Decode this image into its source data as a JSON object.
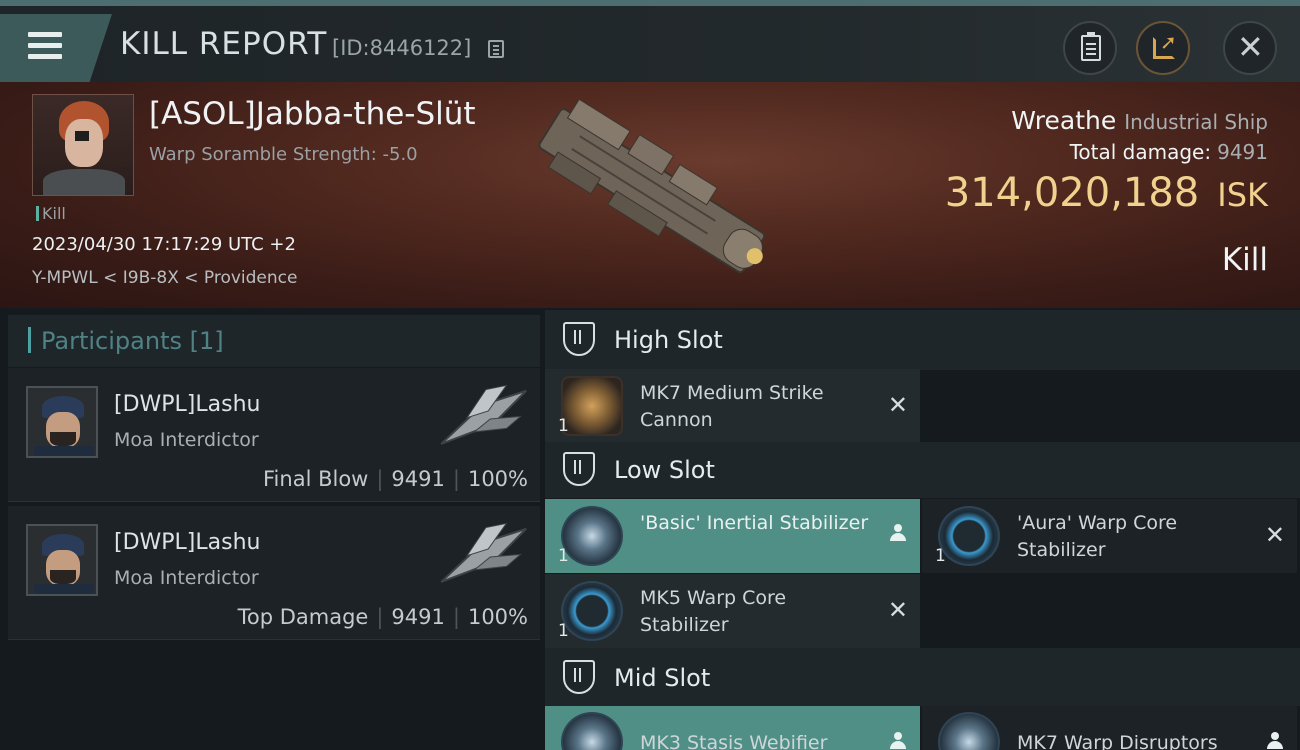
{
  "header": {
    "title": "KILL REPORT",
    "id_label": "[ID:8446122]"
  },
  "victim": {
    "name": "[ASOL]Jabba-the-Slüt",
    "scramble": "Warp Soramble Strength: -5.0",
    "tag": "Kill",
    "timestamp": "2023/04/30 17:17:29 UTC +2",
    "location": "Y-MPWL < I9B-8X < Providence",
    "ship_name": "Wreathe",
    "ship_class": "Industrial Ship",
    "damage_label": "Total damage:",
    "damage_value": "9491",
    "isk_value": "314,020,188",
    "isk_unit": "ISK",
    "result": "Kill"
  },
  "participants": {
    "title": "Participants [1]",
    "items": [
      {
        "name": "[DWPL]Lashu",
        "ship": "Moa Interdictor",
        "role": "Final Blow",
        "damage": "9491",
        "percent": "100%"
      },
      {
        "name": "[DWPL]Lashu",
        "ship": "Moa Interdictor",
        "role": "Top Damage",
        "damage": "9491",
        "percent": "100%"
      }
    ]
  },
  "fitting": {
    "high_slot": {
      "title": "High Slot",
      "modules": [
        {
          "name": "MK7 Medium Strike Cannon",
          "qty": "1",
          "icon": "cannon-icon",
          "state": "destroyed"
        }
      ]
    },
    "low_slot": {
      "title": "Low Slot",
      "modules": [
        {
          "name": "'Basic' Inertial Stabilizer",
          "qty": "1",
          "icon": "inertial-stabilizer-icon",
          "state": "dropped"
        },
        {
          "name": "'Aura' Warp Core Stabilizer",
          "qty": "1",
          "icon": "warp-core-stabilizer-icon",
          "state": "destroyed"
        },
        {
          "name": "MK5 Warp Core Stabilizer",
          "qty": "1",
          "icon": "warp-core-stabilizer-icon",
          "state": "destroyed"
        }
      ]
    },
    "mid_slot": {
      "title": "Mid Slot",
      "modules": [
        {
          "name": "MK3 Stasis Webifier",
          "qty": "",
          "icon": "stasis-webifier-icon",
          "state": "dropped"
        },
        {
          "name": "MK7 Warp Disruptors",
          "qty": "",
          "icon": "warp-disruptor-icon",
          "state": "dropped"
        }
      ]
    }
  },
  "colors": {
    "accent_teal": "#4f8f86",
    "isk_gold": "#f0d18e",
    "banner_red": "#51291f"
  }
}
